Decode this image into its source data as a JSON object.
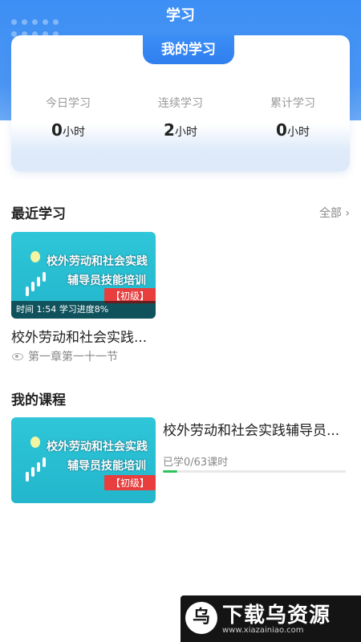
{
  "header": {
    "title": "学习"
  },
  "stats_card": {
    "tab_label": "我的学习",
    "items": [
      {
        "label": "今日学习",
        "value": "0",
        "unit": "小时"
      },
      {
        "label": "连续学习",
        "value": "2",
        "unit": "小时"
      },
      {
        "label": "累计学习",
        "value": "0",
        "unit": "小时"
      }
    ]
  },
  "recent": {
    "section_title": "最近学习",
    "more_label": "全部",
    "item": {
      "thumb_line1": "校外劳动和社会实践",
      "thumb_line2": "辅导员技能培训",
      "thumb_level": "【初级】",
      "overlay": "时间 1:54 学习进度8%",
      "title": "校外劳动和社会实践...",
      "chapter": "第一章第一十一节"
    }
  },
  "courses": {
    "section_title": "我的课程",
    "item": {
      "thumb_line1": "校外劳动和社会实践",
      "thumb_line2": "辅导员技能培训",
      "thumb_level": "【初级】",
      "title": "校外劳动和社会实践辅导员...",
      "progress_text": "已学0/63课时",
      "progress_fraction": 0.08
    }
  },
  "watermark": {
    "logo_glyph": "乌",
    "text": "下载乌资源",
    "url": "www.xiazainiao.com"
  },
  "colors": {
    "accent": "#3d8ff5",
    "progress": "#2ec45b",
    "level_badge": "#e83e3e"
  }
}
